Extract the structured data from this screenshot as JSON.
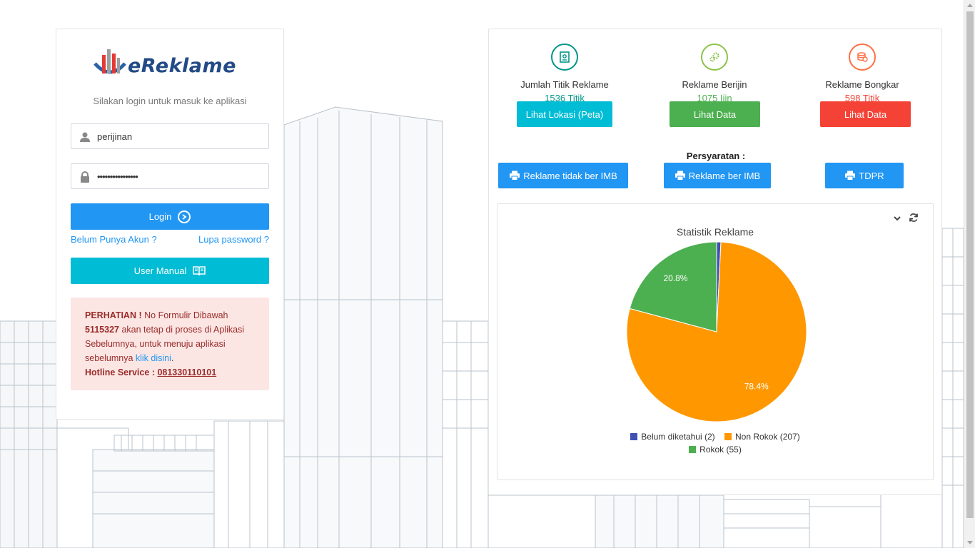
{
  "login": {
    "logo_text": "eReklame",
    "subtitle": "Silakan login untuk masuk ke aplikasi",
    "username_value": "perijinan",
    "password_value": "••••••••••••••••",
    "login_label": "Login",
    "no_account_link": "Belum Punya Akun ?",
    "forgot_link": "Lupa password ?",
    "manual_label": "User Manual",
    "notice": {
      "attention": "PERHATIAN !",
      "text1": " No Formulir Dibawah ",
      "form_number": "5115327",
      "text2": " akan tetap di proses di Aplikasi Sebelumnya, untuk menuju aplikasi sebelumnya ",
      "link": "klik disini",
      "text3": ".",
      "hotline_label": "Hotline Service : ",
      "hotline_number": "081330110101"
    }
  },
  "stats": {
    "items": [
      {
        "label": "Jumlah Titik Reklame",
        "value": "1536 Titik",
        "button": "Lihat Lokasi (Peta)",
        "color": "#00bcd4",
        "icon_color": "#009688"
      },
      {
        "label": "Reklame Berijin",
        "value": "1075 Ijin",
        "button": "Lihat Data",
        "color": "#4caf50",
        "icon_color": "#8bc34a"
      },
      {
        "label": "Reklame Bongkar",
        "value": "598 Titik",
        "button": "Lihat Data",
        "color": "#f44336",
        "icon_color": "#ff7043"
      }
    ]
  },
  "requirements": {
    "label": "Persyaratan :",
    "buttons": [
      "Reklame tidak ber IMB",
      "Reklame ber IMB",
      "TDPR"
    ]
  },
  "chart_data": {
    "type": "pie",
    "title": "Statistik Reklame",
    "series": [
      {
        "name": "Belum diketahui (2)",
        "value": 2,
        "color": "#3f51b5"
      },
      {
        "name": "Non Rokok (207)",
        "value": 207,
        "color": "#ff9800",
        "label": "78.4%"
      },
      {
        "name": "Rokok (55)",
        "value": 55,
        "color": "#4caf50",
        "label": "20.8%"
      }
    ],
    "legend": "bottom"
  },
  "colors": {
    "primary": "#2196f3",
    "teal_value": "#009688",
    "green_value": "#4caf50",
    "red_value": "#f44336"
  }
}
